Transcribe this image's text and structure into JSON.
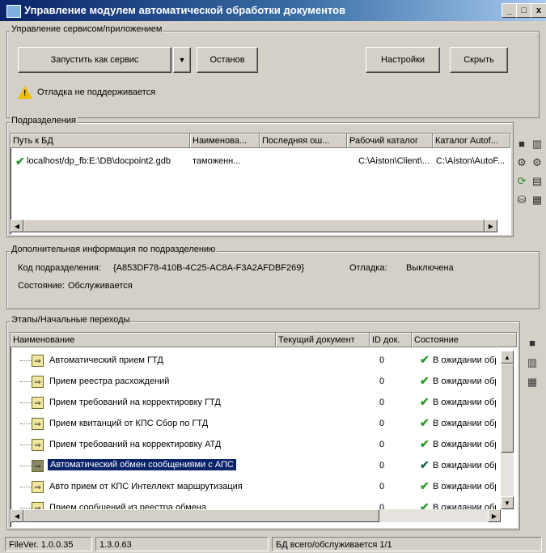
{
  "window": {
    "title": "Управление модулем автоматической обработки документов",
    "min": "_",
    "max": "□",
    "close": "x"
  },
  "service": {
    "group_label": "Управление сервисом/приложением",
    "run_as_service": "Запустить как сервис",
    "dropdown": "▼",
    "stop": "Останов",
    "settings": "Настройки",
    "hide": "Скрыть",
    "warning": "Отладка не поддерживается"
  },
  "departments": {
    "group_label": "Подразделения",
    "columns": [
      "Путь к БД",
      "Наименова...",
      "Последняя ош...",
      "Рабочий каталог",
      "Каталог Autof..."
    ],
    "rows": [
      {
        "path": "localhost/dp_fb:E:\\DB\\docpoint2.gdb",
        "name": "таможенн...",
        "last_error": "",
        "work_dir": "C:\\Aiston\\Client\\...",
        "autof_dir": "C:\\Aiston\\AutoF..."
      }
    ]
  },
  "info": {
    "group_label": "Дополнительная информация по подразделению",
    "code_label": "Код подразделения:",
    "code_value": "{A853DF78-410B-4C25-AC8A-F3A2AFDBF269}",
    "debug_label": "Отладка:",
    "debug_value": "Выключена",
    "state_label": "Состояние:",
    "state_value": "Обслуживается"
  },
  "steps": {
    "group_label": "Этапы/Начальные переходы",
    "columns": [
      "Наименование",
      "Текущий документ",
      "ID док.",
      "Состояние"
    ],
    "rows": [
      {
        "name": "Автоматический прием ГТД",
        "doc": "",
        "id": "0",
        "state": "В ожидании обра"
      },
      {
        "name": "Прием реестра расхождений",
        "doc": "",
        "id": "0",
        "state": "В ожидании обра"
      },
      {
        "name": "Прием требований на корректировку ГТД",
        "doc": "",
        "id": "0",
        "state": "В ожидании обра"
      },
      {
        "name": "Прием квитанций от КПС Сбор по ГТД",
        "doc": "",
        "id": "0",
        "state": "В ожидании обра"
      },
      {
        "name": "Прием требований на корректировку АТД",
        "doc": "",
        "id": "0",
        "state": "В ожидании обра"
      },
      {
        "name": "Автоматический обмен сообщениями с АПС",
        "doc": "",
        "id": "0",
        "state": "В ожидании обра"
      },
      {
        "name": "Авто прием от КПС Интеллект маршрутизация",
        "doc": "",
        "id": "0",
        "state": "В ожидании обра"
      },
      {
        "name": "Прием сообщений из реестра обмена",
        "doc": "",
        "id": "0",
        "state": "В ожидании обра"
      }
    ]
  },
  "statusbar": {
    "filever": "FileVer. 1.0.0.35",
    "version": "1.3.0.63",
    "db": "БД всего/обслуживается 1/1"
  },
  "colors": {
    "titlebar": "#0a246a",
    "check": "#2a9a2a",
    "selection": "#0a246a",
    "face": "#d4d0c8"
  }
}
